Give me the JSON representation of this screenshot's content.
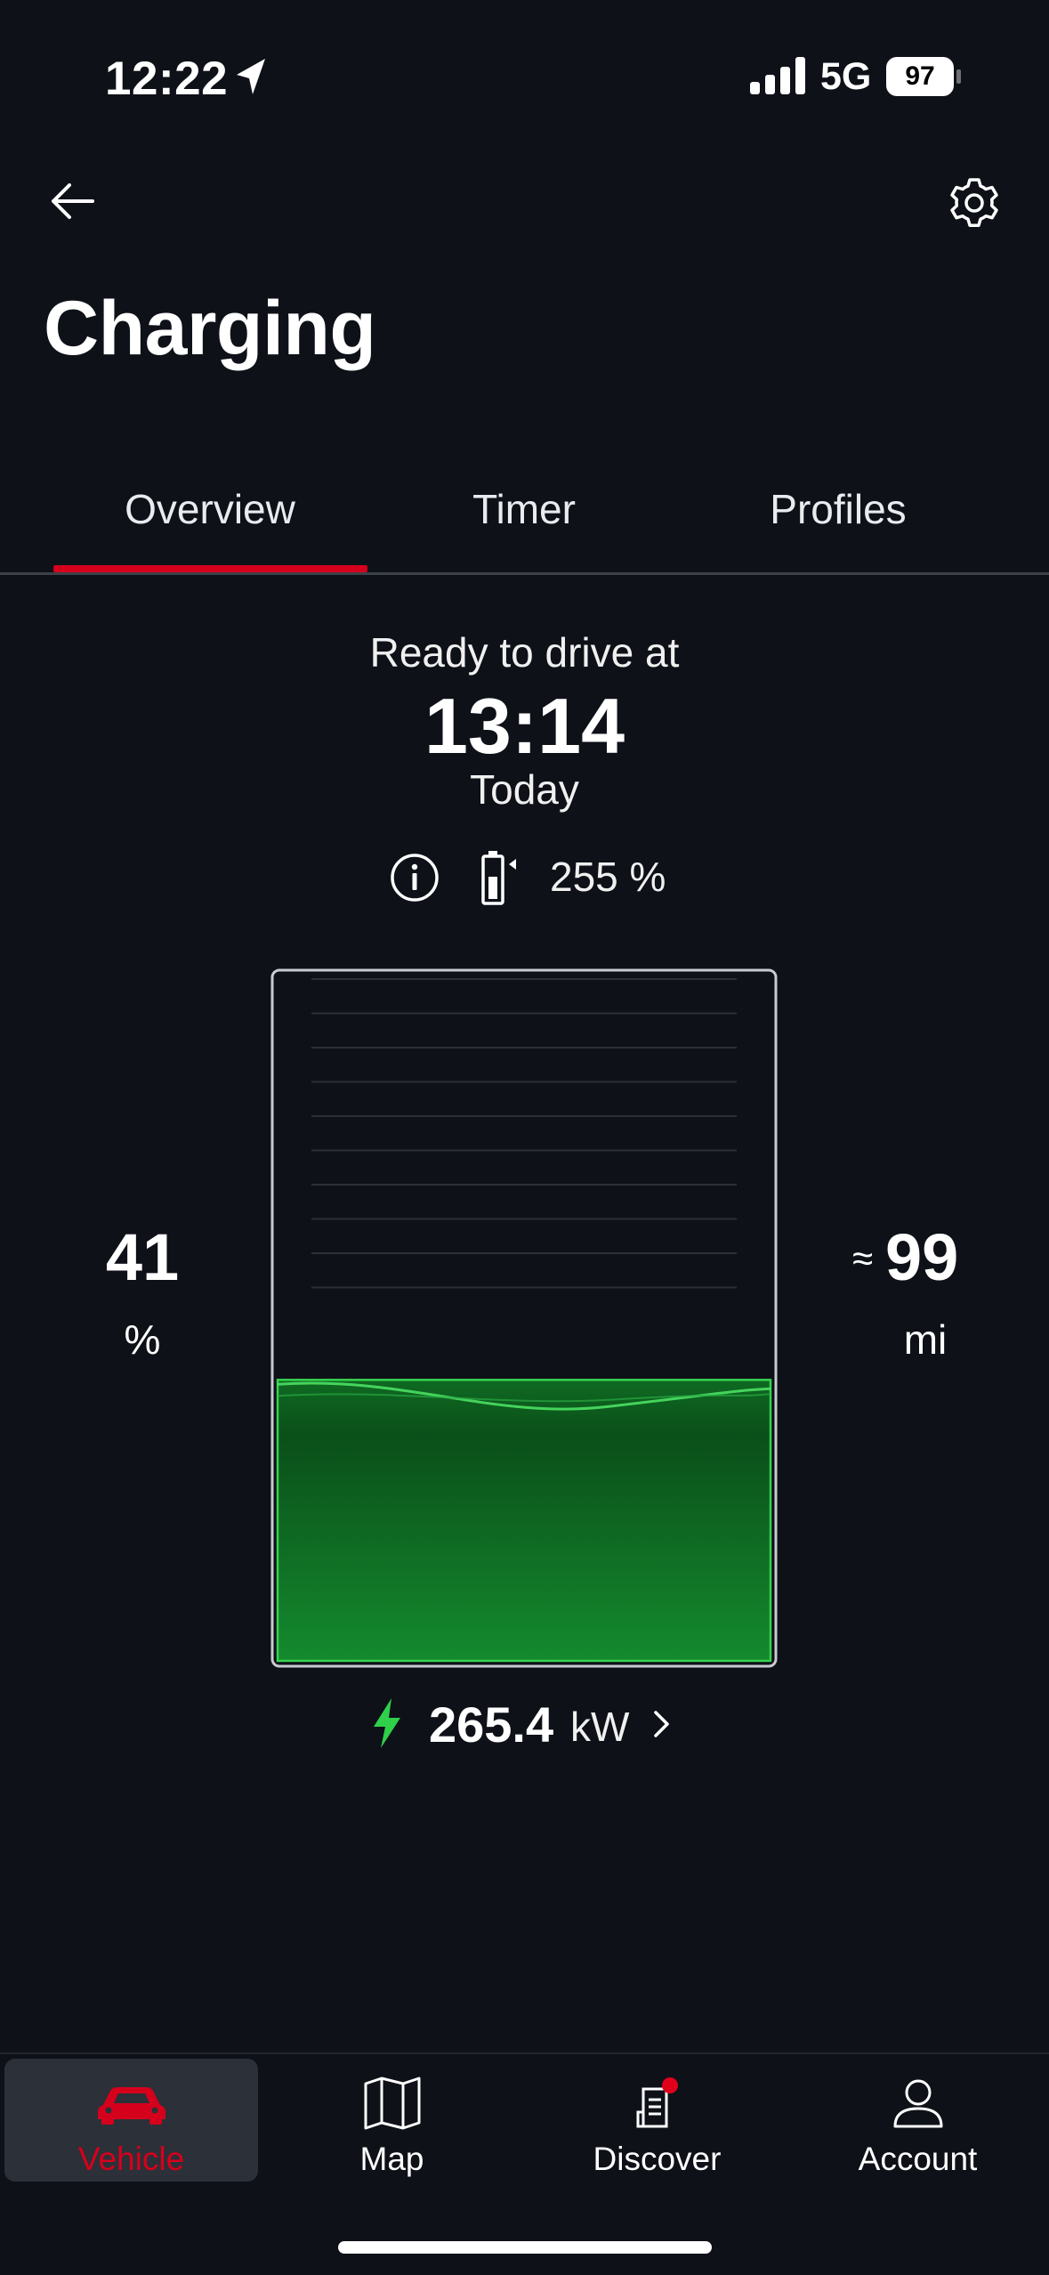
{
  "status_bar": {
    "time": "12:22",
    "network": "5G",
    "battery": "97"
  },
  "header": {
    "title": "Charging",
    "back_icon": "arrow-left-icon",
    "settings_icon": "gear-icon"
  },
  "tabs": [
    {
      "label": "Overview",
      "active": true
    },
    {
      "label": "Timer",
      "active": false
    },
    {
      "label": "Profiles",
      "active": false
    }
  ],
  "ready": {
    "label": "Ready to drive at",
    "time": "13:14",
    "day": "Today"
  },
  "target": {
    "value": "255 %",
    "info_icon": "info-icon",
    "battery_icon": "battery-target-icon"
  },
  "charge": {
    "soc_value": "41",
    "soc_unit": "%",
    "soc_fraction": 0.41,
    "range_approx": "≈",
    "range_value": "99",
    "range_unit": "mi",
    "fill_color": "#1f9e3a"
  },
  "power": {
    "value": "265.4",
    "unit": "kW",
    "icon": "lightning-bolt-icon"
  },
  "bottom_nav": [
    {
      "label": "Vehicle",
      "icon": "car-icon",
      "active": true
    },
    {
      "label": "Map",
      "icon": "map-icon",
      "active": false
    },
    {
      "label": "Discover",
      "icon": "discover-icon",
      "active": false
    },
    {
      "label": "Account",
      "icon": "account-icon",
      "active": false
    }
  ],
  "colors": {
    "accent": "#d5001c",
    "background": "#0e1118",
    "charge_green": "#2fd04a"
  }
}
